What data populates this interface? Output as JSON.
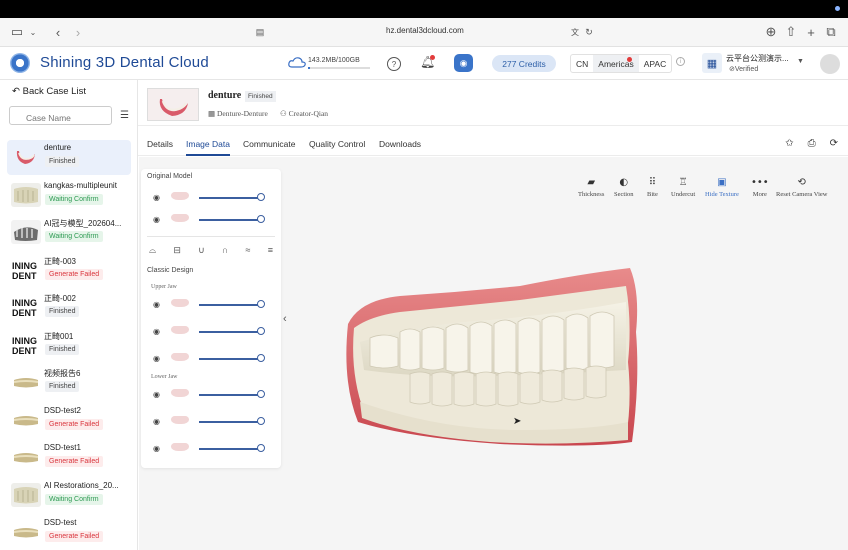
{
  "browser": {
    "url": "hz.dental3dcloud.com"
  },
  "app": {
    "brand": "Shining 3D Dental Cloud",
    "storage": "143.2MB/100GB",
    "storage_fraction": 0.0014,
    "credits": "277 Credits",
    "regions": [
      "CN",
      "Americas",
      "APAC"
    ],
    "active_region": "Americas",
    "org_name": "云平台公测演示...",
    "org_status": "Verified"
  },
  "sidebar": {
    "back_label": "Back Case List",
    "search_placeholder": "Case Name",
    "cases": [
      {
        "name": "denture",
        "status": "Finished",
        "kind": "finished",
        "selected": true
      },
      {
        "name": "kangkas-multipleunit",
        "status": "Waiting Confirm",
        "kind": "waiting"
      },
      {
        "name": "AI冠与模型_202604...",
        "status": "Waiting Confirm",
        "kind": "waiting"
      },
      {
        "name": "正畸-003",
        "status": "Generate Failed",
        "kind": "failed"
      },
      {
        "name": "正畸-002",
        "status": "Finished",
        "kind": "finished"
      },
      {
        "name": "正畸001",
        "status": "Finished",
        "kind": "finished"
      },
      {
        "name": "视频报告6",
        "status": "Finished",
        "kind": "finished"
      },
      {
        "name": "DSD-test2",
        "status": "Generate Failed",
        "kind": "failed"
      },
      {
        "name": "DSD-test1",
        "status": "Generate Failed",
        "kind": "failed"
      },
      {
        "name": "AI Restorations_20...",
        "status": "Waiting Confirm",
        "kind": "waiting"
      },
      {
        "name": "DSD-test",
        "status": "Generate Failed",
        "kind": "failed"
      }
    ]
  },
  "case": {
    "title": "denture",
    "status": "Finished",
    "type": "Denture-Denture",
    "creator": "Creator-Qian"
  },
  "tabs": [
    "Details",
    "Image Data",
    "Communicate",
    "Quality Control",
    "Downloads"
  ],
  "active_tab": "Image Data",
  "panel": {
    "original_model": "Original Model",
    "classic_design": "Classic Design",
    "upper_jaw": "Upper Jaw",
    "lower_jaw": "Lower Jaw"
  },
  "viewer_tools": [
    "Thickness",
    "Section",
    "Bite",
    "Undercut",
    "Hide Texture",
    "More",
    "Reset Camera View"
  ],
  "active_viewer_tool": "Hide Texture"
}
